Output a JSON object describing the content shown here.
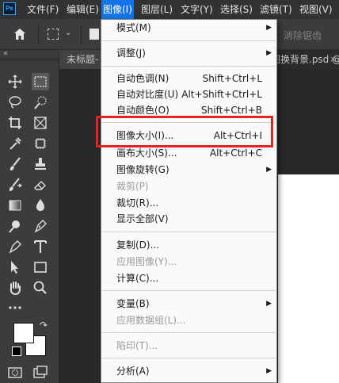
{
  "app": {
    "logo_text": "Ps"
  },
  "menubar": {
    "items": [
      "文件(F)",
      "编辑(E)",
      "图像(I)",
      "图层(L)",
      "文字(Y)",
      "选择(S)",
      "滤镜(T)",
      "视图(V)"
    ],
    "active_index": 2
  },
  "options_bar": {
    "feather_label": "消除锯齿"
  },
  "tabs": {
    "active_label": "未标题-",
    "other_label": "图换背景.psd @",
    "close_glyph": "×"
  },
  "image_menu": {
    "items": [
      {
        "label": "模式(M)",
        "submenu": true
      },
      {
        "label": "调整(J)",
        "submenu": true
      },
      {
        "label": "自动色调(N)",
        "shortcut": "Shift+Ctrl+L"
      },
      {
        "label": "自动对比度(U)",
        "shortcut": "Alt+Shift+Ctrl+L"
      },
      {
        "label": "自动颜色(O)",
        "shortcut": "Shift+Ctrl+B"
      },
      {
        "label": "图像大小(I)...",
        "shortcut": "Alt+Ctrl+I",
        "highlighted": true
      },
      {
        "label": "画布大小(S)...",
        "shortcut": "Alt+Ctrl+C"
      },
      {
        "label": "图像旋转(G)",
        "submenu": true
      },
      {
        "label": "裁剪(P)",
        "disabled": true
      },
      {
        "label": "裁切(R)..."
      },
      {
        "label": "显示全部(V)"
      },
      {
        "label": "复制(D)..."
      },
      {
        "label": "应用图像(Y)...",
        "disabled": true
      },
      {
        "label": "计算(C)..."
      },
      {
        "label": "变量(B)",
        "submenu": true
      },
      {
        "label": "应用数据组(L)...",
        "disabled": true
      },
      {
        "label": "陷印(T)...",
        "disabled": true
      },
      {
        "label": "分析(A)",
        "submenu": true
      }
    ]
  },
  "annotation": {
    "color": "#e52421"
  },
  "colors": {
    "menu_active": "#1473e6",
    "foreground": "#ffffff",
    "background": "#ffffff"
  }
}
